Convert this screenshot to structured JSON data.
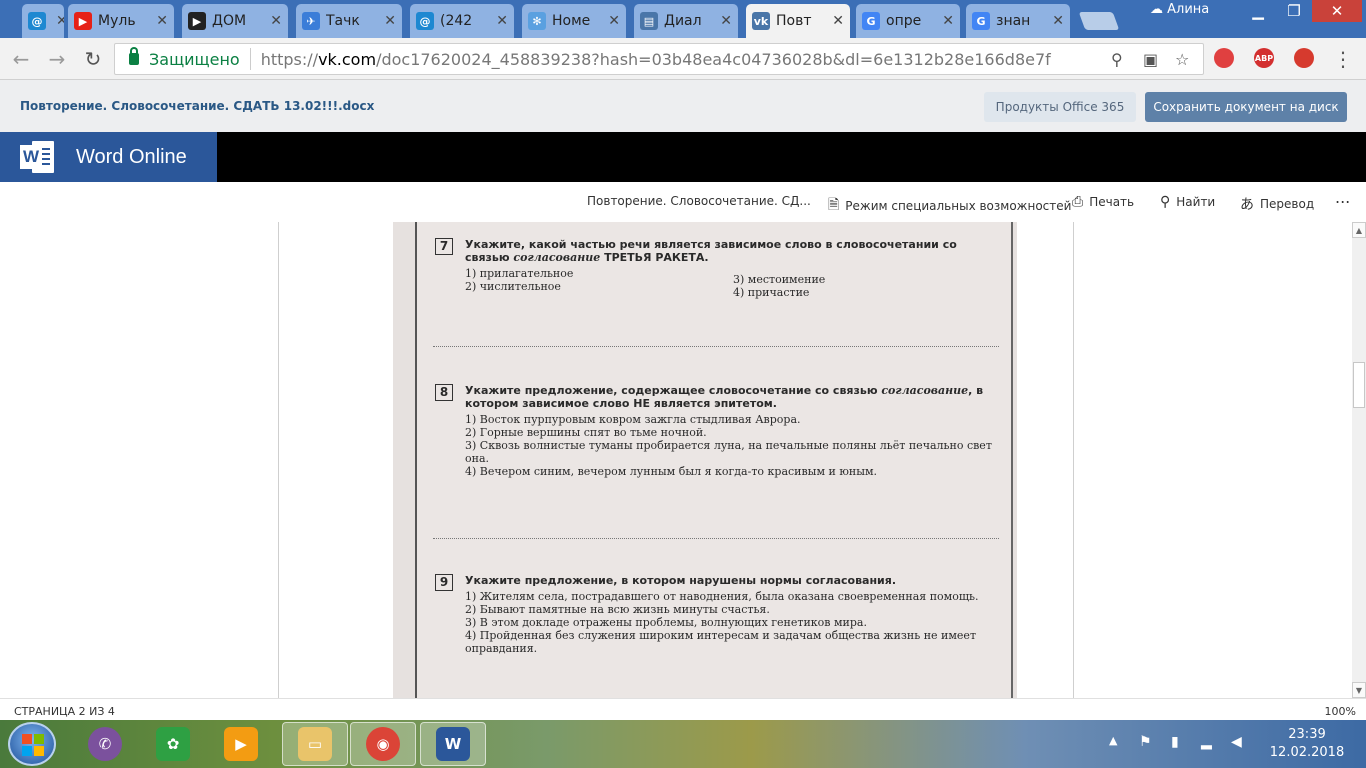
{
  "browser": {
    "tabs": [
      {
        "title": "",
        "icon": "at-sign-icon",
        "color": "#1e88d1"
      },
      {
        "title": "Муль",
        "icon": "youtube-icon",
        "color": "#e62117"
      },
      {
        "title": "ДОМ",
        "icon": "play-icon",
        "color": "#222222"
      },
      {
        "title": "Тачк",
        "icon": "plane-icon",
        "color": "#3b7dd8"
      },
      {
        "title": "(242",
        "icon": "at-sign-icon",
        "color": "#1e88d1"
      },
      {
        "title": "Номе",
        "icon": "gear-icon",
        "color": "#5aa0e0"
      },
      {
        "title": "Диал",
        "icon": "chat-icon",
        "color": "#4a76a8"
      },
      {
        "title": "Повт",
        "icon": "vk-icon",
        "color": "#4a76a8"
      },
      {
        "title": "опре",
        "icon": "google-icon",
        "color": "#4285f4"
      },
      {
        "title": "знан",
        "icon": "google-icon",
        "color": "#4285f4"
      }
    ],
    "profile_name": "Алина",
    "secure_label": "Защищено",
    "url_scheme": "https://",
    "url_host": "vk.com",
    "url_path": "/doc17620024_458839238?hash=03b48ea4c04736028b&dl=6e1312b28e166d8e7f",
    "extensions": [
      {
        "icon": "target-icon",
        "label": "",
        "color": "#e04040"
      },
      {
        "icon": "adblock-icon",
        "label": "ABP",
        "color": "#d32f2f"
      },
      {
        "icon": "shield-stop-icon",
        "label": "",
        "color": "#d63a2e"
      }
    ]
  },
  "vk": {
    "doc_title": "Повторение. Словосочетание. СДАТЬ 13.02!!!.docx",
    "office_button": "Продукты Office 365",
    "save_button": "Сохранить документ на диск"
  },
  "word": {
    "app_name": "Word Online",
    "commands": {
      "doc_name": "Повторение. Словосочетание. СД...",
      "accessibility": "Режим специальных возможностей",
      "print": "Печать",
      "find": "Найти",
      "translate": "Перевод",
      "more": "..."
    },
    "status": {
      "page_indicator": "СТРАНИЦА 2 ИЗ 4",
      "zoom": "100%"
    }
  },
  "document": {
    "questions": [
      {
        "number": "7",
        "prompt_start": "Укажите, какой частью речи является зависимое слово в словосочетании со связью ",
        "prompt_em": "согласование",
        "prompt_end": " ТРЕТЬЯ РАКЕТА.",
        "options_left": [
          "1) прилагательное",
          "2) числительное"
        ],
        "options_right": [
          "3) местоимение",
          "4) причастие"
        ]
      },
      {
        "number": "8",
        "prompt_start": "Укажите предложение, содержащее словосочетание со связью ",
        "prompt_em": "согласование",
        "prompt_end": ", в котором зависимое слово НЕ является эпитетом.",
        "options": [
          "1) Восток пурпуровым ковром зажгла стыдливая Аврора.",
          "2) Горные вершины спят во тьме ночной.",
          "3) Сквозь волнистые туманы пробирается луна, на печальные поляны льёт печально свет она.",
          "4) Вечером синим, вечером лунным был я когда-то красивым и юным."
        ]
      },
      {
        "number": "9",
        "prompt": "Укажите предложение, в котором нарушены нормы согласования.",
        "options": [
          "1) Жителям села, пострадавшего от наводнения, была оказана своевременная помощь.",
          "2) Бывают памятные на всю жизнь минуты счастья.",
          "3) В этом докладе отражены проблемы, волнующих генетиков мира.",
          "4) Пройденная без служения широким интересам и задачам общества жизнь не имеет оправдания."
        ]
      }
    ]
  },
  "taskbar": {
    "apps": [
      {
        "icon": "viber-icon",
        "color": "#7b519d"
      },
      {
        "icon": "icq-flower-icon",
        "color": "#2ea043"
      },
      {
        "icon": "media-player-icon",
        "color": "#f39c12"
      },
      {
        "icon": "file-explorer-icon",
        "color": "#e9c46a"
      },
      {
        "icon": "chrome-icon",
        "color": "#db4437"
      },
      {
        "icon": "word-icon",
        "color": "#2b579a"
      }
    ],
    "time": "23:39",
    "date": "12.02.2018"
  }
}
